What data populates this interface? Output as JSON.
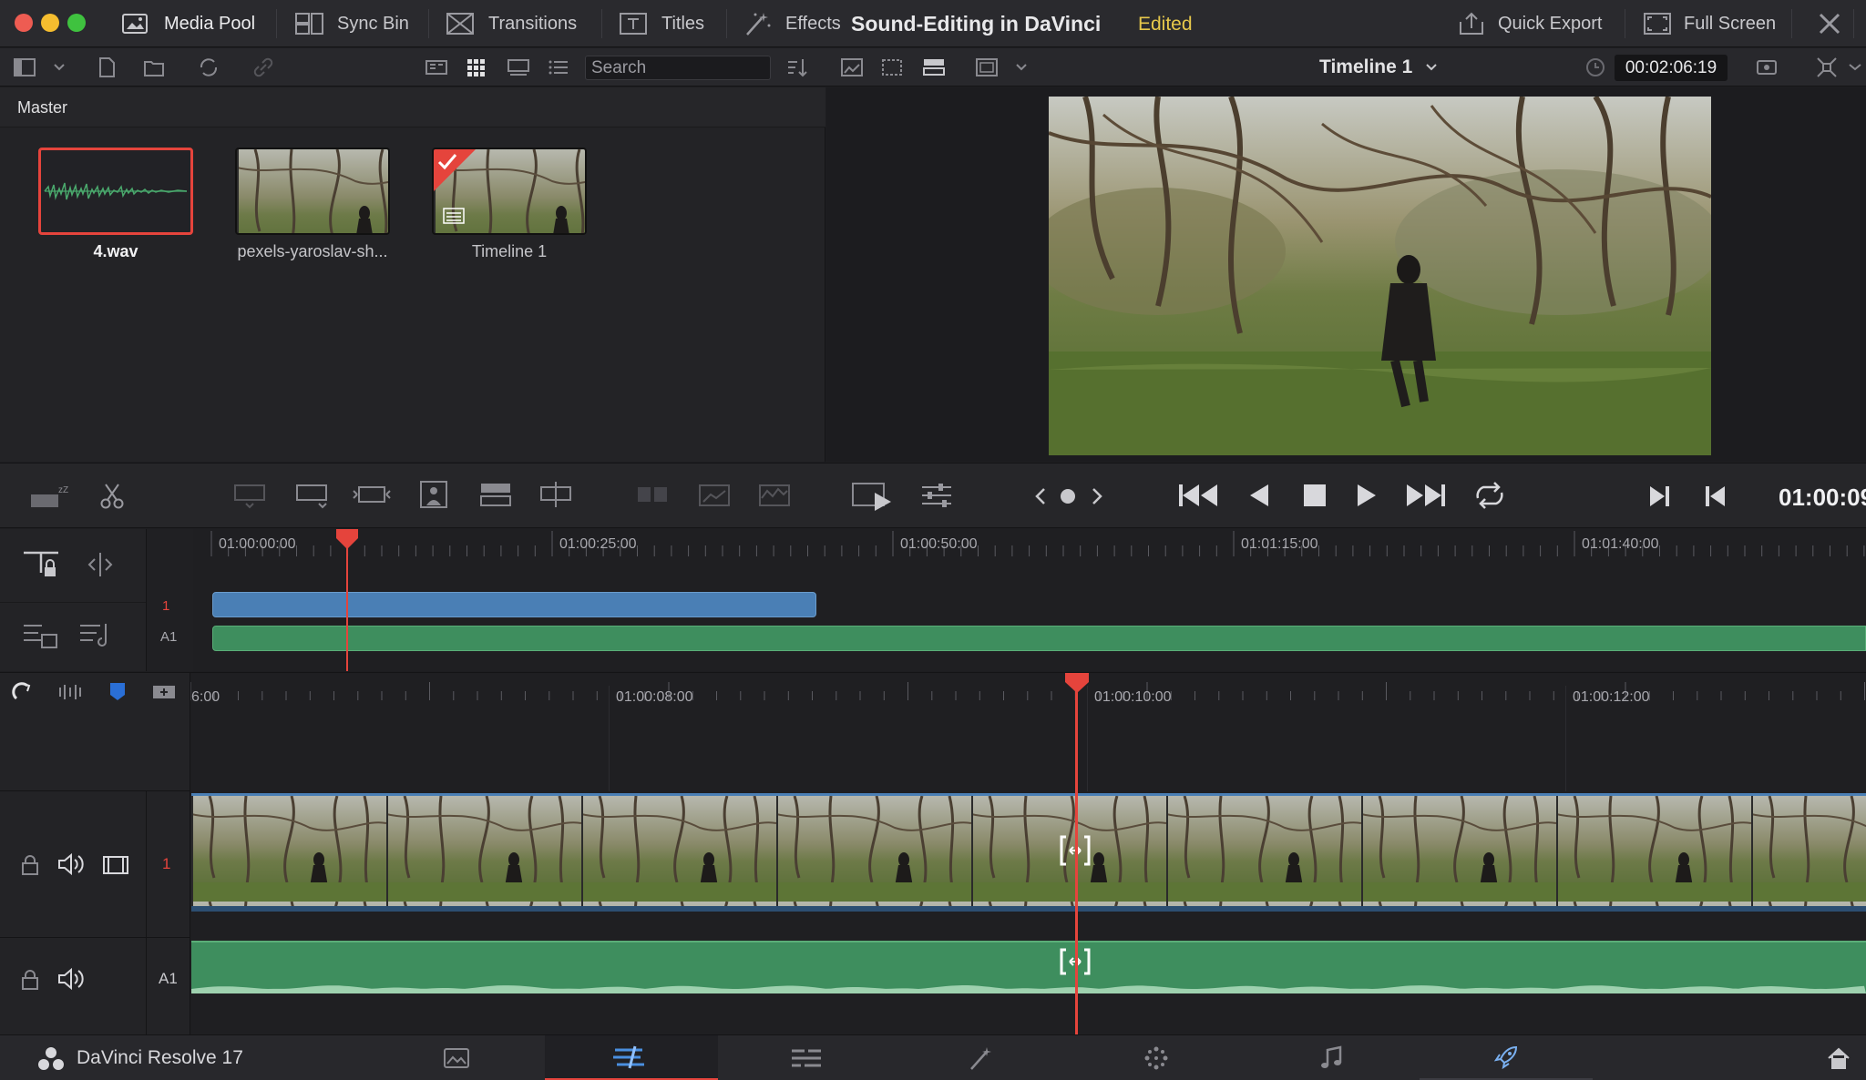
{
  "window": {
    "project_title": "Sound-Editing in DaVinci",
    "project_status": "Edited"
  },
  "topbar": {
    "media_pool": "Media Pool",
    "sync_bin": "Sync Bin",
    "transitions": "Transitions",
    "titles": "Titles",
    "effects": "Effects",
    "quick_export": "Quick Export",
    "full_screen": "Full Screen"
  },
  "toolbar": {
    "search_placeholder": "Search",
    "timeline_name": "Timeline 1",
    "source_timecode": "00:02:06:19"
  },
  "media_pool": {
    "bin_name": "Master",
    "clips": [
      {
        "label": "4.wav"
      },
      {
        "label": "pexels-yaroslav-sh..."
      },
      {
        "label": "Timeline 1"
      }
    ]
  },
  "transport": {
    "timecode": "01:00:09"
  },
  "upper_timeline": {
    "ruler": [
      "01:00:00:00",
      "01:00:25:00",
      "01:00:50:00",
      "01:01:15:00",
      "01:01:40:00"
    ],
    "tracks": [
      "1",
      "A1"
    ]
  },
  "lower_timeline": {
    "ruler": [
      "6:00",
      "01:00:08:00",
      "01:00:10:00",
      "01:00:12:00"
    ],
    "video_track": "1",
    "audio_track": "A1"
  },
  "bottombar": {
    "app_name": "DaVinci Resolve 17"
  },
  "colors": {
    "accent_red": "#e5443c",
    "audio_green": "#3e8e5e",
    "video_blue": "#4a7fb5",
    "status_yellow": "#e6c84b"
  }
}
